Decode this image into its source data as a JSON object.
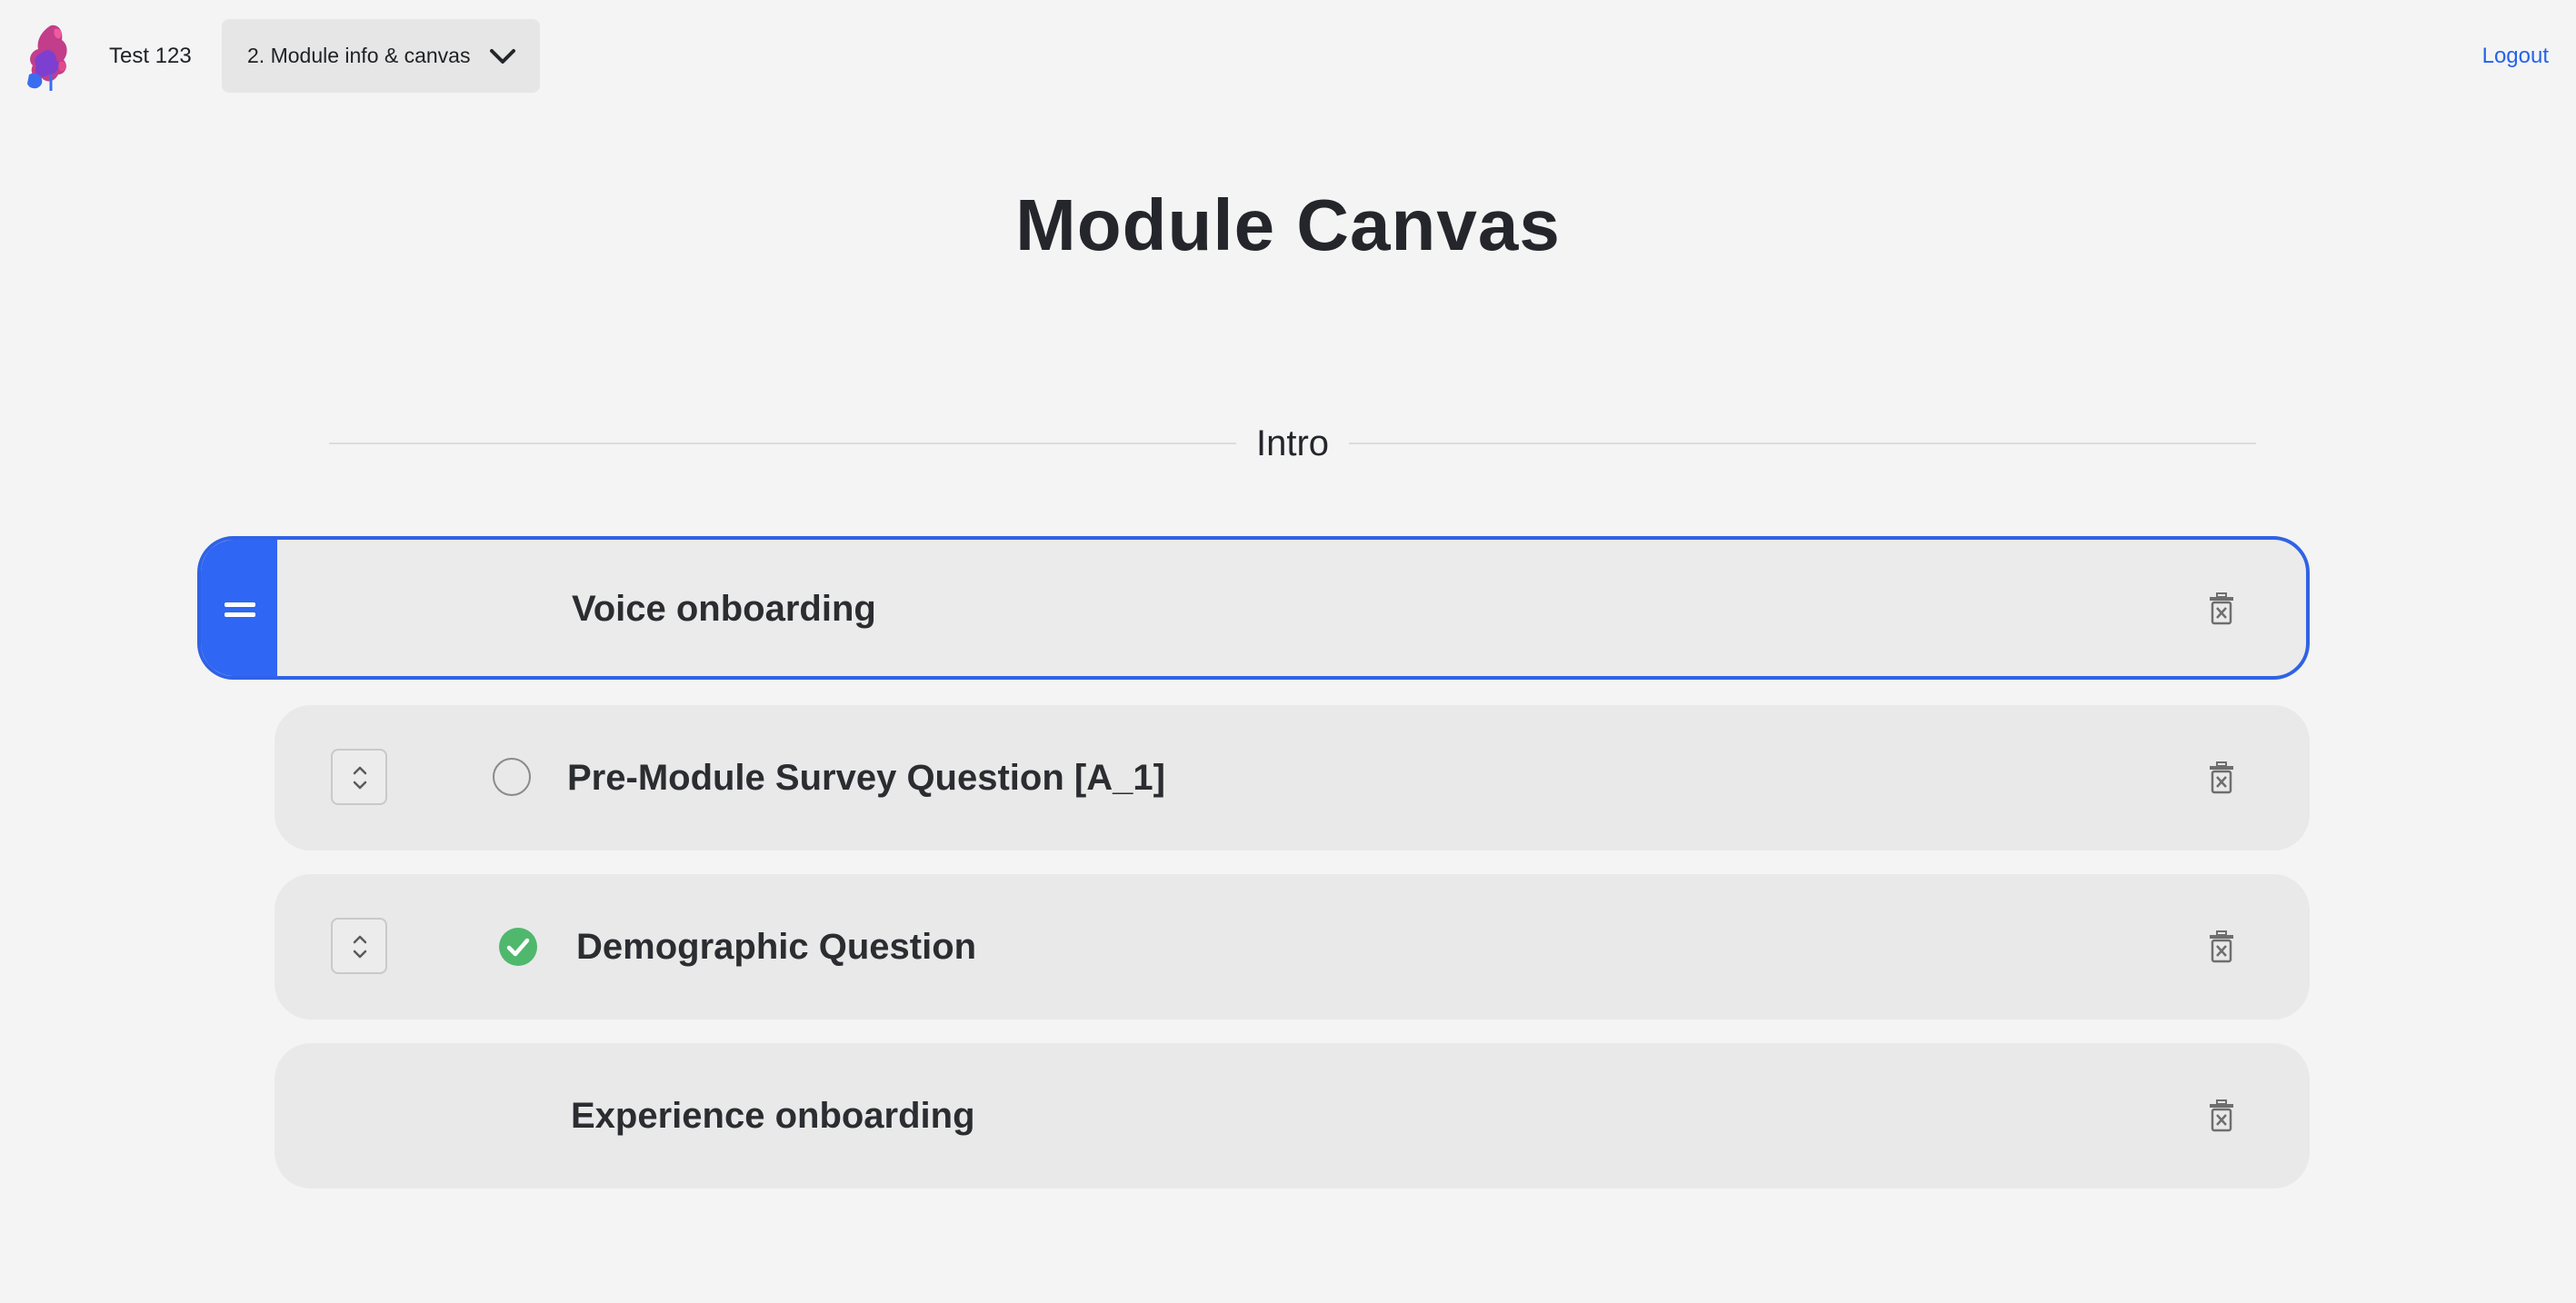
{
  "header": {
    "project_name": "Test 123",
    "step_select_value": "2. Module info & canvas",
    "logout_label": "Logout"
  },
  "page_title": "Module Canvas",
  "section": {
    "label": "Intro"
  },
  "items": [
    {
      "title": "Voice onboarding",
      "status": "none",
      "state": "dragging"
    },
    {
      "title": "Pre-Module Survey Question [A_1]",
      "status": "incomplete"
    },
    {
      "title": "Demographic Question",
      "status": "complete"
    },
    {
      "title": "Experience onboarding",
      "status": "none"
    }
  ],
  "colors": {
    "accent": "#2f66f3",
    "link": "#2563eb",
    "complete": "#4fb86d",
    "card_bg": "#e9e9e9",
    "page_bg": "#f4f4f4"
  },
  "icons": {
    "logo": "ink-splash-logo",
    "dropdown": "chevron-down-icon",
    "drag": "drag-handle-icon",
    "reorder": "reorder-stepper-icon",
    "delete": "trash-icon",
    "complete": "check-circle-icon",
    "incomplete": "empty-circle-icon"
  }
}
